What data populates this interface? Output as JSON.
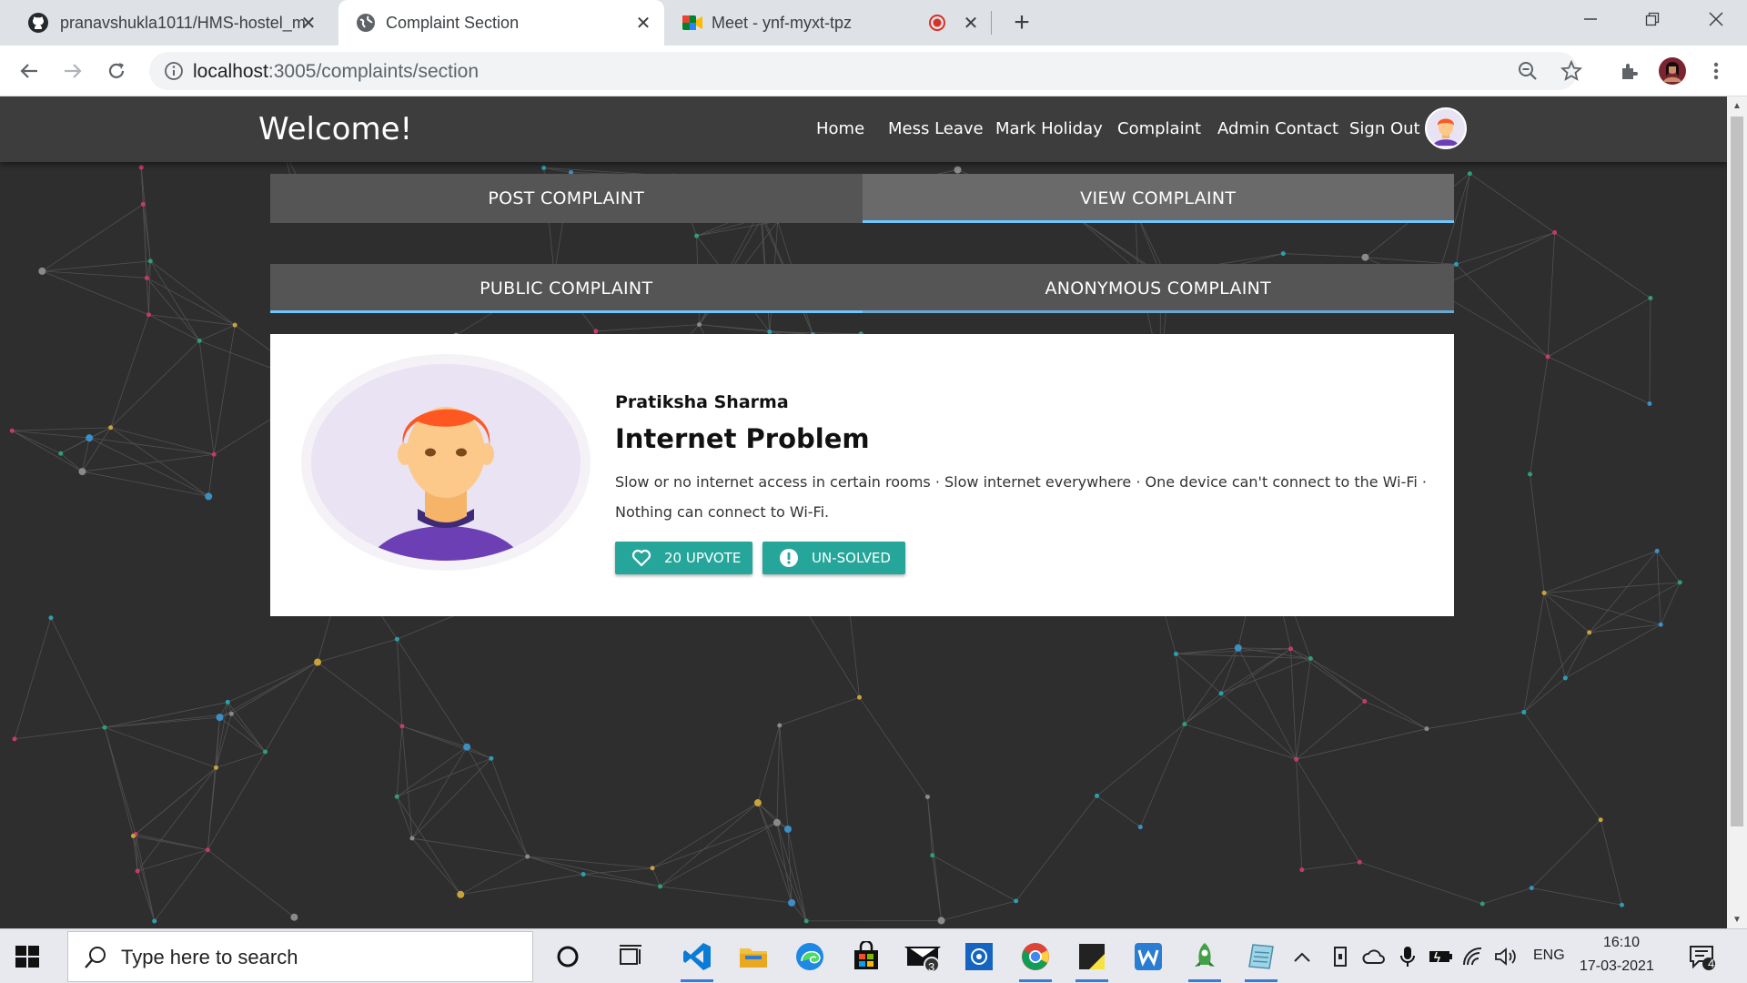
{
  "browser": {
    "tabs": [
      {
        "title": "pranavshukla1011/HMS-hostel_m",
        "icon": "github-icon",
        "active": false
      },
      {
        "title": "Complaint Section",
        "icon": "globe-icon",
        "active": true
      },
      {
        "title": "Meet - ynf-myxt-tpz",
        "icon": "meet-icon",
        "active": false
      }
    ],
    "url_host": "localhost",
    "url_path": ":3005/complaints/section"
  },
  "app": {
    "brand": "Welcome!",
    "nav": [
      "Home",
      "Mess Leave",
      "Mark Holiday",
      "Complaint",
      "Admin Contact",
      "Sign Out"
    ],
    "main_tabs": [
      {
        "label": "POST COMPLAINT",
        "selected": false
      },
      {
        "label": "VIEW COMPLAINT",
        "selected": true
      }
    ],
    "sub_tabs": [
      {
        "label": "PUBLIC COMPLAINT",
        "selected": true
      },
      {
        "label": "ANONYMOUS COMPLAINT",
        "selected": false
      }
    ],
    "complaint": {
      "author": "Pratiksha Sharma",
      "title": "Internet Problem",
      "description": "Slow or no internet access in certain rooms · Slow internet everywhere · One device can't connect to the Wi-Fi · Nothing can connect to Wi-Fi.",
      "upvote_label": "20 UPVOTE",
      "status_label": "UN-SOLVED"
    },
    "colors": {
      "appbar": "#3d3d3d",
      "background": "#2e2e2e",
      "chip": "#26a69a",
      "tab_indicator": "#6ec6ff"
    }
  },
  "taskbar": {
    "search_placeholder": "Type here to search",
    "mail_badge": "3",
    "language": "ENG",
    "time": "16:10",
    "date": "17-03-2021",
    "notification_count": "4"
  }
}
